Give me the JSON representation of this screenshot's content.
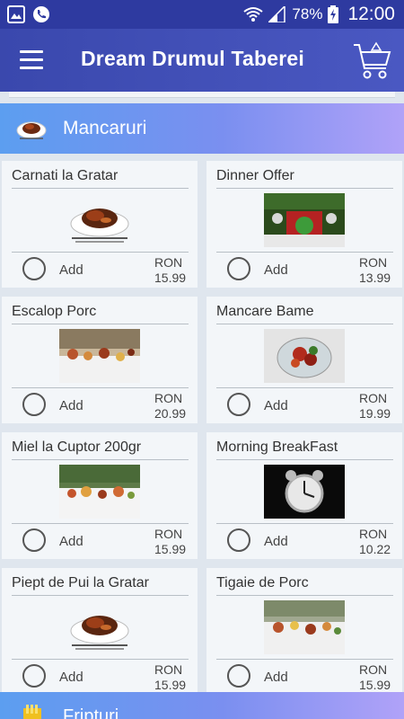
{
  "status_bar": {
    "battery": "78%",
    "time": "12:00"
  },
  "toolbar": {
    "title": "Dream Drumul Taberei"
  },
  "categories": [
    {
      "name": "Mancaruri"
    },
    {
      "name": "Fripturi"
    }
  ],
  "items": [
    {
      "name": "Carnati la Gratar",
      "image": "plate",
      "add_label": "Add",
      "currency": "RON",
      "price": "15.99"
    },
    {
      "name": "Dinner Offer",
      "image": "restaurant-photo",
      "add_label": "Add",
      "currency": "RON",
      "price": "13.99"
    },
    {
      "name": "Escalop Porc",
      "image": "buffet",
      "add_label": "Add",
      "currency": "RON",
      "price": "20.99"
    },
    {
      "name": "Mancare Bame",
      "image": "salad-bowl",
      "add_label": "Add",
      "currency": "RON",
      "price": "19.99"
    },
    {
      "name": "Miel la Cuptor 200gr",
      "image": "buffet",
      "add_label": "Add",
      "currency": "RON",
      "price": "15.99"
    },
    {
      "name": "Morning BreakFast",
      "image": "alarm-clock",
      "add_label": "Add",
      "currency": "RON",
      "price": "10.22"
    },
    {
      "name": "Piept de Pui la Gratar",
      "image": "plate",
      "add_label": "Add",
      "currency": "RON",
      "price": "15.99"
    },
    {
      "name": "Tigaie de Porc",
      "image": "buffet",
      "add_label": "Add",
      "currency": "RON",
      "price": "15.99"
    }
  ],
  "colors": {
    "status_bar": "#2e3aa0",
    "toolbar": "#4150b8",
    "category_start": "#5c9ef0",
    "category_end": "#b0a2f8"
  }
}
